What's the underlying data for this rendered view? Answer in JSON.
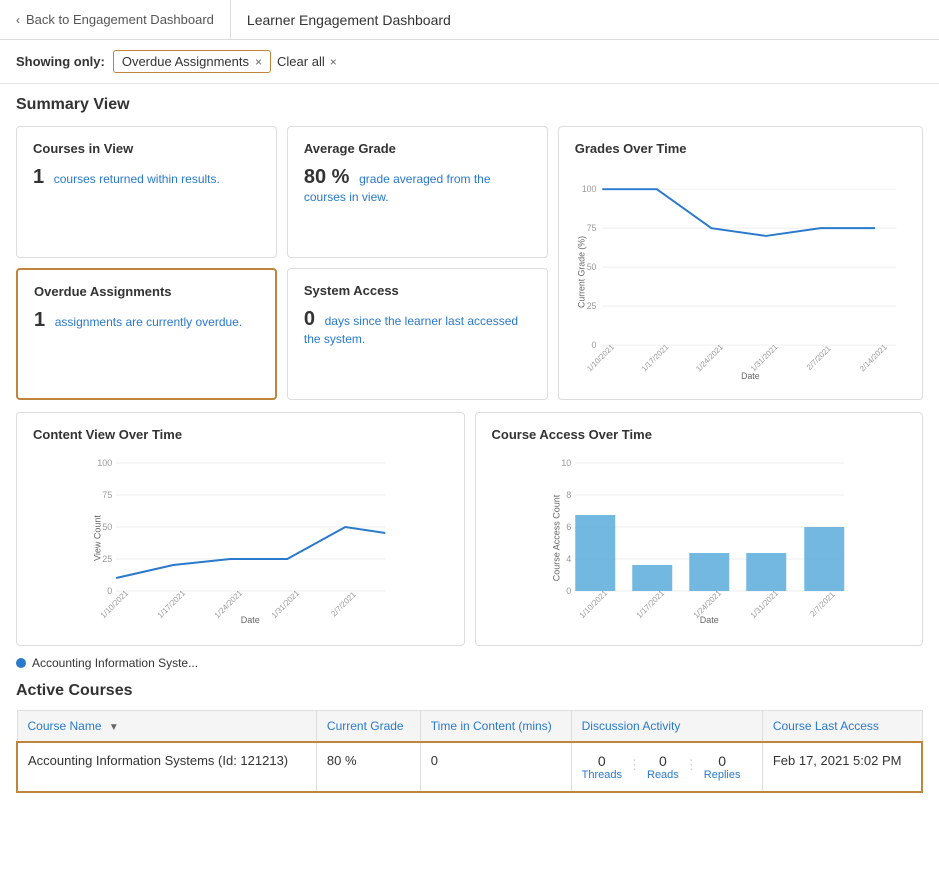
{
  "nav": {
    "back_label": "Back to Engagement Dashboard",
    "title": "Learner Engagement Dashboard"
  },
  "filter": {
    "showing_label": "Showing only:",
    "tag_label": "Overdue Assignments",
    "clear_label": "Clear all"
  },
  "summary_view": {
    "title": "Summary View",
    "cards": {
      "courses_in_view": {
        "title": "Courses in View",
        "value": "1",
        "desc": "courses returned within results."
      },
      "average_grade": {
        "title": "Average Grade",
        "value": "80 %",
        "desc": "grade averaged from the courses in view."
      },
      "overdue_assignments": {
        "title": "Overdue Assignments",
        "value": "1",
        "desc": "assignments are currently overdue."
      },
      "system_access": {
        "title": "System Access",
        "value": "0",
        "desc": "days since the learner last accessed the system."
      },
      "grades_over_time": {
        "title": "Grades Over Time",
        "y_axis_label": "Current Grade (%)",
        "x_axis_label": "Date"
      },
      "content_view": {
        "title": "Content View Over Time",
        "y_axis_label": "View Count",
        "x_axis_label": "Date"
      },
      "course_access": {
        "title": "Course Access Over Time",
        "y_axis_label": "Course Access Count",
        "x_axis_label": "Date"
      }
    }
  },
  "legend": {
    "label": "Accounting Information Syste..."
  },
  "active_courses": {
    "title": "Active Courses",
    "columns": [
      "Course Name",
      "Current Grade",
      "Time in Content (mins)",
      "Discussion Activity",
      "Course Last Access"
    ],
    "rows": [
      {
        "course_name": "Accounting Information Systems (Id: 121213)",
        "current_grade": "80 %",
        "time_in_content": "0",
        "threads": "0",
        "reads": "0",
        "replies": "0",
        "last_access": "Feb 17, 2021 5:02 PM"
      }
    ]
  },
  "chart_dates": {
    "grades": [
      "1/10/2021",
      "1/17/2021",
      "1/24/2021",
      "1/31/2021",
      "2/7/2021",
      "2/14/2021"
    ],
    "content": [
      "1/10/2021",
      "1/17/2021",
      "1/24/2021",
      "1/31/2021",
      "2/7/2021"
    ],
    "access": [
      "1/10/2021",
      "1/17/2021",
      "1/24/2021",
      "1/31/2021",
      "2/7/2021"
    ]
  }
}
